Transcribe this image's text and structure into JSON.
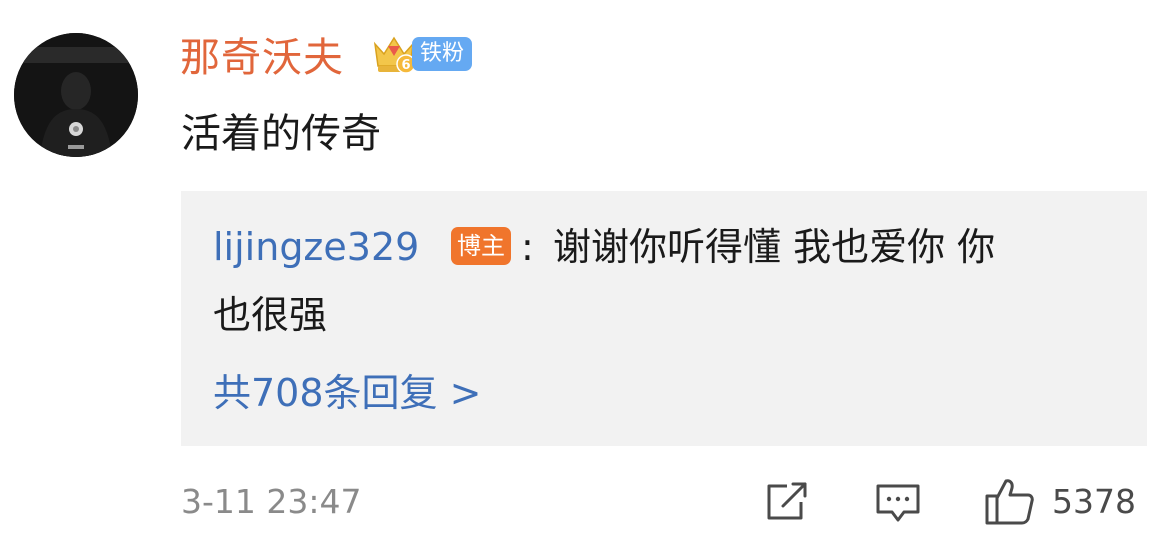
{
  "comment": {
    "username": "那奇沃夫",
    "fan_badge": "铁粉",
    "fan_level": "6",
    "text": "活着的传奇",
    "timestamp": "3-11 23:47",
    "like_count": "5378"
  },
  "reply": {
    "author": "lijingze329",
    "author_badge": "博主",
    "separator": ":",
    "text_line1": "谢谢你听得懂 我也爱你 你",
    "text_line2": "也很强",
    "more_replies": "共708条回复 >"
  },
  "icons": {
    "share": "share-icon",
    "comment": "comment-icon",
    "like": "thumbs-up-icon",
    "crown": "crown-badge-icon"
  },
  "colors": {
    "username": "#e1663b",
    "link_blue": "#3e6fb8",
    "fan_badge_bg": "#65a9f2",
    "blogger_badge_bg": "#f0752c",
    "reply_bg": "#f2f2f2"
  }
}
